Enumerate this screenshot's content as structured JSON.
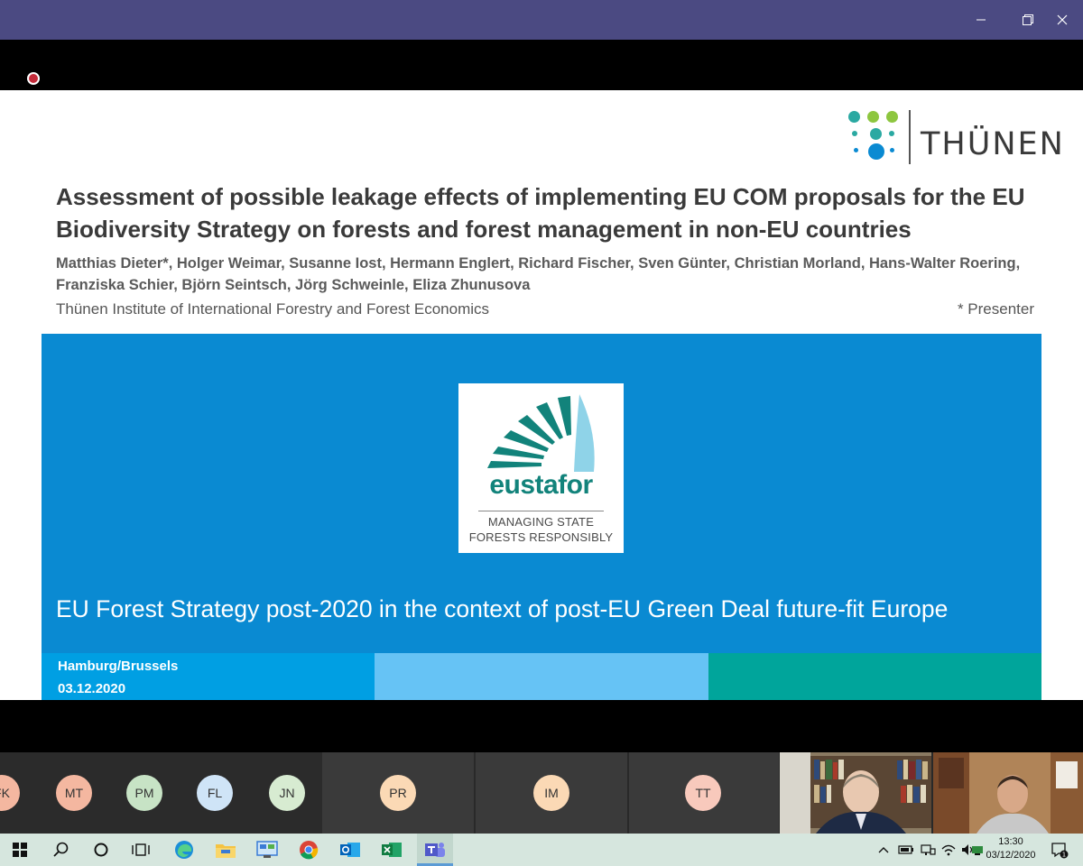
{
  "window": {
    "controls": [
      "minimize-icon",
      "restore-icon",
      "close-icon"
    ],
    "accent": "#4b4a82"
  },
  "slide": {
    "logo_text": "THÜNEN",
    "title": "Assessment of possible leakage effects of implementing EU COM proposals for the EU Biodiversity Strategy on forests and forest management in non-EU countries",
    "authors": "Matthias Dieter*, Holger Weimar, Susanne Iost, Hermann Englert, Richard Fischer, Sven Günter, Christian Morland, Hans-Walter Roering, Franziska Schier, Björn Seintsch, Jörg Schweinle, Eliza Zhunusova",
    "institute": "Thünen Institute of International Forestry and Forest Economics",
    "presenter_note": "* Presenter",
    "panel": {
      "logo_word": "eustafor",
      "logo_sub1": "MANAGING STATE",
      "logo_sub2": "FORESTS RESPONSIBLY",
      "caption": "EU Forest Strategy post-2020 in the context of post-EU Green Deal future-fit Europe",
      "location": "Hamburg/Brussels",
      "date": "03.12.2020",
      "colors": {
        "panel": "#0a8ad2",
        "strip1": "#009fe3",
        "strip2": "#66c3f5",
        "strip3": "#00a59b"
      }
    }
  },
  "participants": [
    {
      "initials": "FK",
      "color": "#f4b7a0"
    },
    {
      "initials": "MT",
      "color": "#f4b7a0"
    },
    {
      "initials": "PM",
      "color": "#c7e3c5"
    },
    {
      "initials": "FL",
      "color": "#cfe4f7"
    },
    {
      "initials": "JN",
      "color": "#d7ebd1"
    },
    {
      "initials": "PR",
      "color": "#fbd9b5"
    },
    {
      "initials": "IM",
      "color": "#fbd9b5"
    },
    {
      "initials": "TT",
      "color": "#f8c9bc"
    }
  ],
  "taskbar": {
    "apps": [
      "windows-start-icon",
      "search-icon",
      "cortana-icon",
      "task-view-icon",
      "edge-icon",
      "file-explorer-icon",
      "control-panel-icon",
      "chrome-icon",
      "outlook-icon",
      "excel-icon",
      "teams-icon"
    ],
    "tray": [
      "chevron-up-icon",
      "battery-icon",
      "network-icon",
      "wifi-icon",
      "volume-icon",
      "input-icon"
    ],
    "time": "13:30",
    "date": "03/12/2020",
    "notifications": "1"
  }
}
